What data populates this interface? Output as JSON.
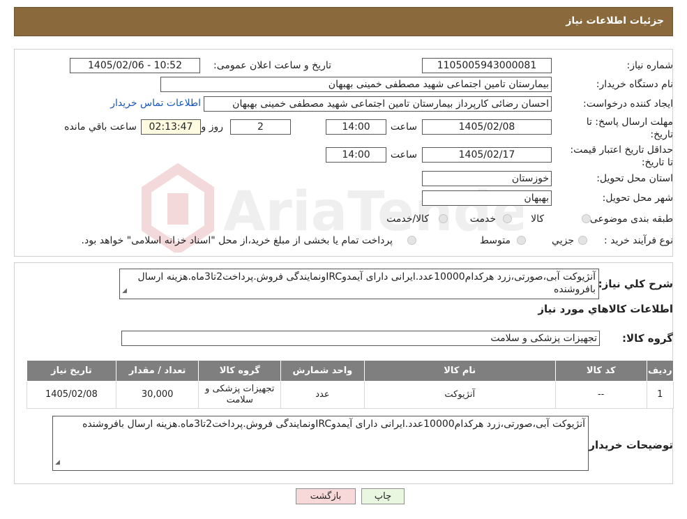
{
  "header": {
    "title": "جزئیات اطلاعات نیاز"
  },
  "form": {
    "need_number_label": "شماره نیاز:",
    "need_number": "1105005943000081",
    "announce_label": "تاریخ و ساعت اعلان عمومی:",
    "announce_value": "1405/02/06 - 10:52",
    "buyer_org_label": "نام دستگاه خریدار:",
    "buyer_org": "بیمارستان تامین اجتماعی شهید مصطفی خمینی بهبهان",
    "creator_label": "ایجاد کننده درخواست:",
    "creator": "احسان رضائی کارپرداز بیمارستان تامین اجتماعی شهید مصطفی خمینی بهبهان",
    "contact_link": "اطلاعات تماس خریدار",
    "reply_deadline_label": "مهلت ارسال پاسخ: تا تاریخ:",
    "reply_date": "1405/02/08",
    "time_label": "ساعت",
    "reply_time": "14:00",
    "days_value": "2",
    "days_label": "روز و",
    "remaining_time": "02:13:47",
    "remaining_label": "ساعت باقي مانده",
    "price_valid_label": "حداقل تاریخ اعتبار قیمت: تا تاریخ:",
    "price_date": "1405/02/17",
    "price_time": "14:00",
    "province_label": "استان محل تحویل:",
    "province": "خوزستان",
    "city_label": "شهر محل تحویل:",
    "city": "بهبهان",
    "category_label": "طبقه بندی موضوعی:",
    "category_options": [
      "کالا",
      "خدمت",
      "کالا/خدمت"
    ],
    "process_label": "نوع فرآیند خرید :",
    "process_options": [
      "جزیي",
      "متوسط"
    ],
    "process_note": "پرداخت تمام یا بخشی از مبلغ خرید،از محل \"اسناد خزانه اسلامی\" خواهد بود."
  },
  "summary": {
    "label": "شرح کلي نياز:",
    "text": "آنژیوکت آبی،صورتی،زرد هرکدام10000عدد.ایرانی دارای آیمدوIRCونمایندگی فروش.پرداخت2تا3ماه.هزینه ارسال بافروشنده"
  },
  "goods": {
    "section_title": "اطلاعات کالاهاي مورد نياز",
    "group_label": "گروه کالا:",
    "group_value": "تجهیزات پزشکی و سلامت",
    "table": {
      "headers": [
        "رديف",
        "کد کالا",
        "نام کالا",
        "واحد شمارش",
        "گروه کالا",
        "تعداد / مقدار",
        "تاريخ نياز"
      ],
      "rows": [
        [
          "1",
          "--",
          "آنژیوکت",
          "عدد",
          "تجهیزات پزشکی و سلامت",
          "30,000",
          "1405/02/08"
        ]
      ]
    },
    "buyer_desc_label": "توضیحات خریدار:",
    "buyer_desc": "آنژیوکت آبی،صورتی،زرد هرکدام10000عدد.ایرانی دارای آیمدوIRCونمایندگی فروش.پرداخت2تا3ماه.هزینه ارسال بافروشنده"
  },
  "buttons": {
    "print": "چاپ",
    "back": "بازگشت"
  },
  "watermark": {
    "text": "AriaTender.neT"
  },
  "colors": {
    "header_bg": "#8a6a3c",
    "link": "#1a55b8",
    "table_header": "#7f7f7f",
    "back_btn": "#f8d9d9",
    "print_btn": "#e9f7e0"
  }
}
